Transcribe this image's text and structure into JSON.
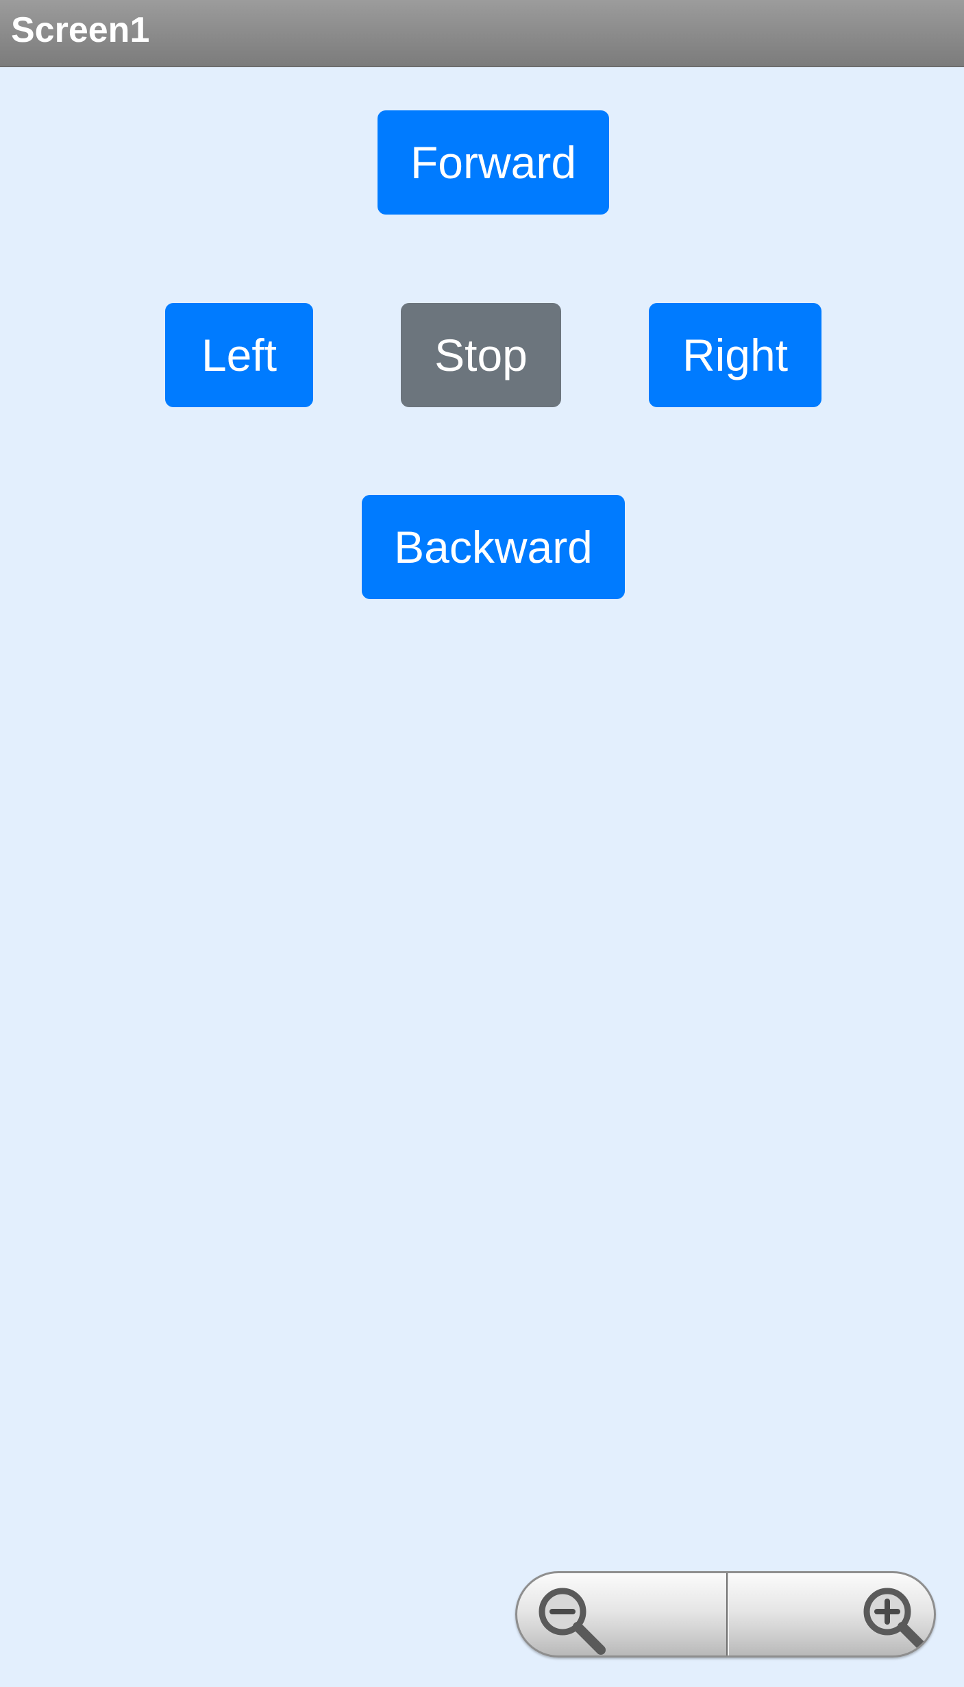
{
  "app": {
    "title": "Screen1"
  },
  "controls": {
    "forward_label": "Forward",
    "left_label": "Left",
    "stop_label": "Stop",
    "right_label": "Right",
    "backward_label": "Backward"
  },
  "zoom": {
    "out_icon": "zoom-out-icon",
    "in_icon": "zoom-in-icon"
  },
  "colors": {
    "background": "#e3effd",
    "primary_button": "#007bff",
    "stop_button": "#6c757d",
    "titlebar": "#8a8a8a"
  }
}
